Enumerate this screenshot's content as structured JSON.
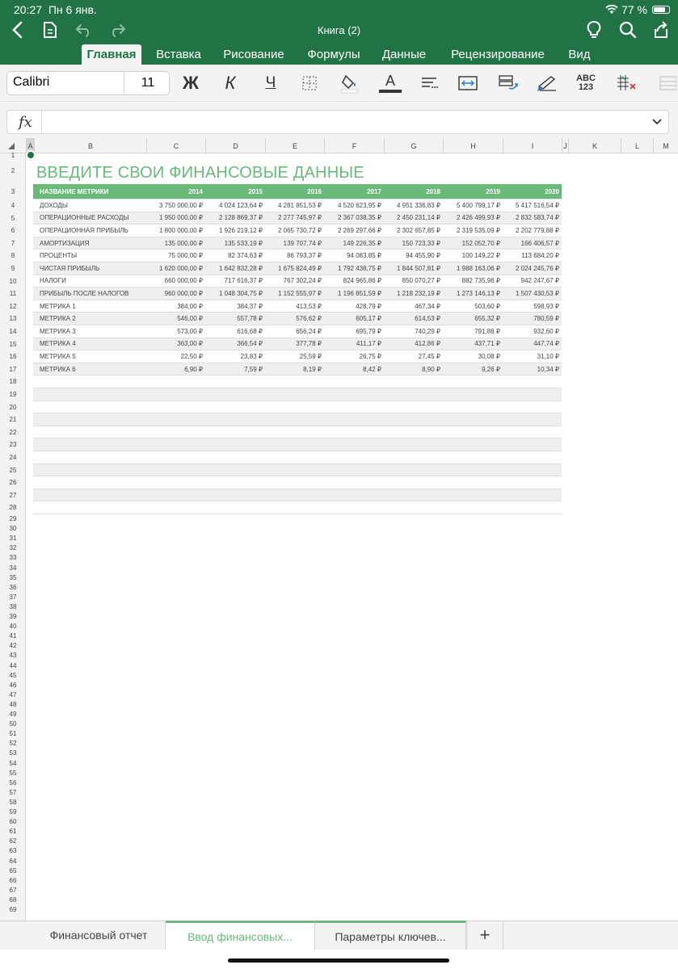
{
  "status": {
    "time": "20:27",
    "date": "Пн 6 янв.",
    "battery": "77 %"
  },
  "window": {
    "title": "Книга (2)"
  },
  "ribbon_tabs": [
    "Главная",
    "Вставка",
    "Рисование",
    "Формулы",
    "Данные",
    "Рецензирование",
    "Вид"
  ],
  "toolbar": {
    "font_name": "Calibri",
    "font_size": "11",
    "bold": "Ж",
    "italic": "К",
    "underline": "Ч",
    "font_color": "А",
    "spelling": "ABC\n123"
  },
  "formula_bar": {
    "label": "fx",
    "value": ""
  },
  "columns": [
    "A",
    "B",
    "C",
    "D",
    "E",
    "F",
    "G",
    "H",
    "I",
    "J",
    "K",
    "L",
    "M"
  ],
  "rows": [
    "1",
    "2",
    "3",
    "4",
    "5",
    "6",
    "7",
    "8",
    "9",
    "10",
    "11",
    "12",
    "13",
    "14",
    "15",
    "16",
    "17",
    "18",
    "19",
    "20",
    "21",
    "22",
    "23",
    "24",
    "25",
    "26",
    "27",
    "28",
    "29",
    "30",
    "31",
    "32",
    "33",
    "34",
    "35",
    "36",
    "37",
    "38",
    "39",
    "40",
    "41",
    "42",
    "43",
    "44",
    "45",
    "46",
    "47",
    "48",
    "49",
    "50",
    "51",
    "52",
    "53",
    "54",
    "55",
    "56",
    "57",
    "58",
    "59",
    "60",
    "61",
    "62",
    "63",
    "64",
    "65",
    "66",
    "67",
    "68",
    "69"
  ],
  "sheet": {
    "title": "ВВЕДИТЕ СВОИ ФИНАНСОВЫЕ ДАННЫЕ",
    "header": [
      "НАЗВАНИЕ МЕТРИКИ",
      "2014",
      "2015",
      "2016",
      "2017",
      "2018",
      "2019",
      "2020"
    ],
    "data": [
      [
        "ДОХОДЫ",
        "3 750 000,00 ₽",
        "4 024 123,64 ₽",
        "4 281 851,53 ₽",
        "4 520 623,95 ₽",
        "4 951 336,83 ₽",
        "5 400 799,17 ₽",
        "5 417 516,54 ₽"
      ],
      [
        "ОПЕРАЦИОННЫЕ РАСХОДЫ",
        "1 950 000,00 ₽",
        "2 128 869,37 ₽",
        "2 277 745,97 ₽",
        "2 367 038,35 ₽",
        "2 450 231,14 ₽",
        "2 426 499,93 ₽",
        "2 832 583,74 ₽"
      ],
      [
        "ОПЕРАЦИОННАЯ ПРИБЫЛЬ",
        "1 800 000,00 ₽",
        "1 926 219,12 ₽",
        "2 065 730,72 ₽",
        "2 269 297,66 ₽",
        "2 302 657,85 ₽",
        "2 319 535,09 ₽",
        "2 202 779,88 ₽"
      ],
      [
        "АМОРТИЗАЦИЯ",
        "135 000,00 ₽",
        "135 533,19 ₽",
        "139 707,74 ₽",
        "149 226,35 ₽",
        "150 723,33 ₽",
        "152 052,70 ₽",
        "166 406,57 ₽"
      ],
      [
        "ПРОЦЕНТЫ",
        "75 000,00 ₽",
        "82 374,63 ₽",
        "86 793,37 ₽",
        "94 083,85 ₽",
        "94 455,90 ₽",
        "100 149,22 ₽",
        "113 684,20 ₽"
      ],
      [
        "ЧИСТАЯ ПРИБЫЛЬ",
        "1 620 000,00 ₽",
        "1 642 832,28 ₽",
        "1 675 824,49 ₽",
        "1 792 438,75 ₽",
        "1 844 507,81 ₽",
        "1 988 163,06 ₽",
        "2 024 245,76 ₽"
      ],
      [
        "НАЛОГИ",
        "660 000,00 ₽",
        "717 616,37 ₽",
        "767 302,24 ₽",
        "824 965,86 ₽",
        "850 070,27 ₽",
        "882 735,96 ₽",
        "942 247,67 ₽"
      ],
      [
        "ПРИБЫЛЬ ПОСЛЕ НАЛОГОВ",
        "960 000,00 ₽",
        "1 048 304,75 ₽",
        "1 152 555,97 ₽",
        "1 196 851,59 ₽",
        "1 218 232,19 ₽",
        "1 273 146,13 ₽",
        "1 507 430,53 ₽"
      ],
      [
        "МЕТРИКА 1",
        "384,00 ₽",
        "384,37 ₽",
        "413,53 ₽",
        "428,79 ₽",
        "467,34 ₽",
        "503,60 ₽",
        "598,93 ₽"
      ],
      [
        "МЕТРИКА 2",
        "546,00 ₽",
        "557,78 ₽",
        "576,62 ₽",
        "605,17 ₽",
        "614,53 ₽",
        "655,32 ₽",
        "780,59 ₽"
      ],
      [
        "МЕТРИКА 3",
        "573,00 ₽",
        "616,68 ₽",
        "656,24 ₽",
        "695,79 ₽",
        "740,29 ₽",
        "791,88 ₽",
        "932,60 ₽"
      ],
      [
        "МЕТРИКА 4",
        "363,00 ₽",
        "366,54 ₽",
        "377,78 ₽",
        "411,17 ₽",
        "412,86 ₽",
        "437,71 ₽",
        "447,74 ₽"
      ],
      [
        "МЕТРИКА 5",
        "22,50 ₽",
        "23,83 ₽",
        "25,59 ₽",
        "26,75 ₽",
        "27,45 ₽",
        "30,08 ₽",
        "31,10 ₽"
      ],
      [
        "МЕТРИКА 6",
        "6,90 ₽",
        "7,59 ₽",
        "8,19 ₽",
        "8,42 ₽",
        "8,90 ₽",
        "9,26 ₽",
        "10,34 ₽"
      ]
    ]
  },
  "sheet_tabs": [
    "Финансовый отчет",
    "Ввод финансовых...",
    "Параметры ключев..."
  ],
  "add_sheet": "+",
  "colors": {
    "brand": "#217346",
    "accent": "#6ab97a"
  }
}
